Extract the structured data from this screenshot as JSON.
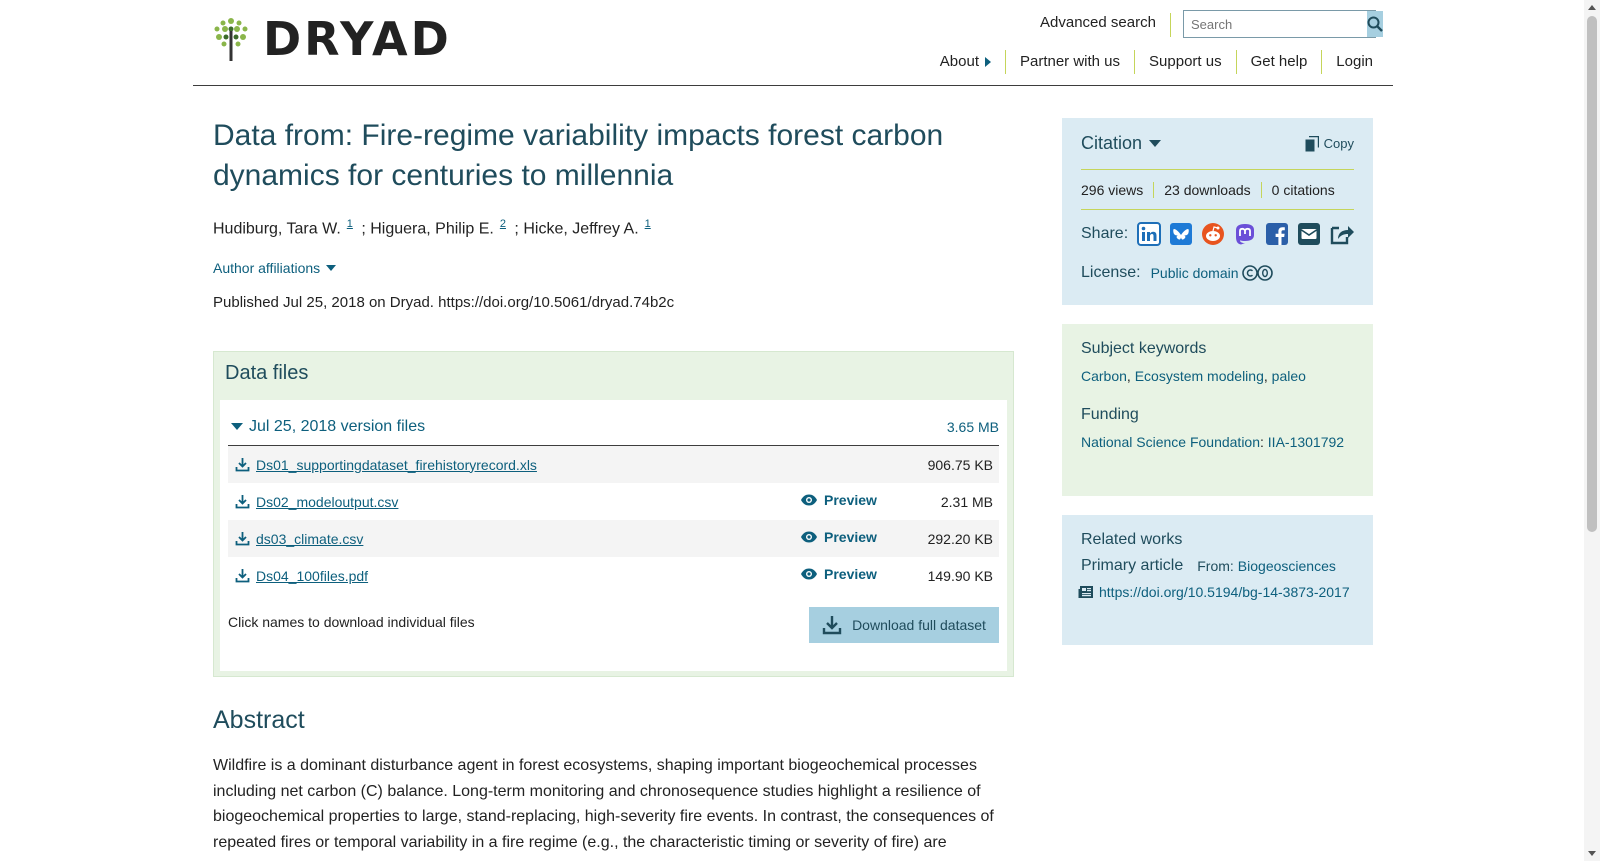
{
  "header": {
    "logo_text": "DRYAD",
    "advanced_search": "Advanced search",
    "search_placeholder": "Search",
    "nav": [
      "About",
      "Partner with us",
      "Support us",
      "Get help",
      "Login"
    ]
  },
  "dataset": {
    "title": "Data from: Fire-regime variability impacts forest carbon dynamics for centuries to millennia",
    "authors": [
      {
        "name": "Hudiburg, Tara W.",
        "affil": "1",
        "sep": " ;"
      },
      {
        "name": "Higuera, Philip E.",
        "affil": "2",
        "sep": " ;"
      },
      {
        "name": "Hicke, Jeffrey A.",
        "affil": "1",
        "sep": ""
      }
    ],
    "author_affiliations": "Author affiliations",
    "published": "Published Jul 25, 2018 on Dryad. https://doi.org/10.5061/dryad.74b2c"
  },
  "data_files": {
    "heading": "Data files",
    "version_label": "Jul 25, 2018 version files",
    "version_size": "3.65 MB",
    "files": [
      {
        "name": "Ds01_supportingdataset_firehistoryrecord.xls",
        "size": "906.75 KB",
        "preview": ""
      },
      {
        "name": "Ds02_modeloutput.csv",
        "size": "2.31 MB",
        "preview": "Preview"
      },
      {
        "name": "ds03_climate.csv",
        "size": "292.20 KB",
        "preview": "Preview"
      },
      {
        "name": "Ds04_100files.pdf",
        "size": "149.90 KB",
        "preview": "Preview"
      }
    ],
    "note": "Click names to download individual files",
    "download_full": "Download full dataset"
  },
  "abstract": {
    "heading": "Abstract",
    "text": "Wildfire is a dominant disturbance agent in forest ecosystems, shaping important biogeochemical processes including net carbon (C) balance. Long-term monitoring and chronosequence studies highlight a resilience of biogeochemical properties to large, stand-replacing, high-severity fire events. In contrast, the consequences of repeated fires or temporal variability in a fire regime (e.g., the characteristic timing or severity of fire) are"
  },
  "citation": {
    "label": "Citation",
    "copy": "Copy",
    "views": "296 views",
    "downloads": "23 downloads",
    "citations": "0 citations",
    "share_label": "Share:",
    "share_icons": [
      "linkedin-icon",
      "bluesky-icon",
      "reddit-icon",
      "mastodon-icon",
      "facebook-icon",
      "email-icon",
      "share-icon"
    ],
    "license_label": "License:",
    "license_value": "Public domain"
  },
  "keywords": {
    "heading": "Subject keywords",
    "items": [
      "Carbon",
      "Ecosystem modeling",
      "paleo"
    ],
    "funding_heading": "Funding",
    "funder": "National Science Foundation",
    "award": "IIA-1301792"
  },
  "related": {
    "heading": "Related works",
    "primary": "Primary article",
    "from_label": "From:",
    "from_value": "Biogeosciences",
    "doi": "https://doi.org/10.5194/bg-14-3873-2017"
  },
  "colors": {
    "accent": "#0d5f7d",
    "green_divider": "#c5d55a",
    "blue_panel": "#dbebf3",
    "green_panel": "#e8f3e4",
    "button": "#a6cfe0"
  }
}
